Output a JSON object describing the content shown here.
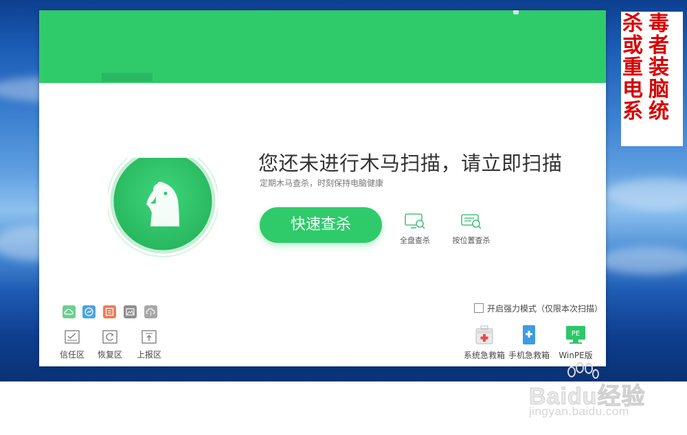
{
  "main": {
    "title": "您还未进行木马扫描，请立即扫描",
    "subtitle": "定期木马查杀，时刻保持电脑健康",
    "scan_button": "快速查杀",
    "full_scan": "全盘查杀",
    "location_scan": "按位置查杀"
  },
  "bottom_left": {
    "trust": "信任区",
    "restore": "恢复区",
    "report": "上报区"
  },
  "bottom_right": {
    "strong_mode": "开启强力模式（仅限本次扫描）",
    "system_rescue": "系统急救箱",
    "phone_rescue": "手机急救箱",
    "winpe": "WinPE版",
    "pe_icon_text": "PE"
  },
  "annotation": {
    "col1": "杀或重电系",
    "col2": "毒者装脑统"
  },
  "watermark": {
    "logo": "Baidu经验",
    "url": "jingyan.baidu.com"
  },
  "colors": {
    "brand_green": "#2fcb6b",
    "annotation_red": "#d80000"
  }
}
